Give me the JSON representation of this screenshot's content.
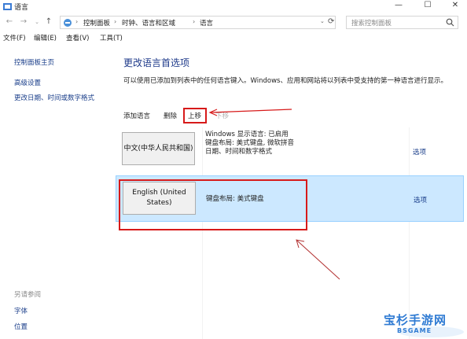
{
  "window": {
    "title": "语言",
    "controls": [
      "—",
      "☐",
      "✕"
    ]
  },
  "address": {
    "breadcrumbs": [
      "控制面板",
      "时钟、语言和区域",
      "语言"
    ],
    "search_placeholder": "搜索控制面板"
  },
  "menu": [
    "文件(F)",
    "编辑(E)",
    "查看(V)",
    "工具(T)"
  ],
  "sidebar": {
    "links": [
      "控制面板主页",
      "高级设置",
      "更改日期、时间或数字格式"
    ],
    "see_also_title": "另请参阅",
    "see_also_links": [
      "字体",
      "位置"
    ]
  },
  "main": {
    "heading": "更改语言首选项",
    "description": "可以使用已添加到列表中的任何语言键入。Windows、应用和网站将以列表中受支持的第一种语言进行显示。",
    "toolbar": {
      "add": "添加语言",
      "remove": "删除",
      "move_up": "上移",
      "move_down": "下移"
    },
    "languages": [
      {
        "name": "中文(中华人民共和国)",
        "info": "Windows 显示语言: 已启用\n键盘布局: 美式键盘, 微软拼音\n日期、时间和数字格式",
        "options": "选项"
      },
      {
        "name": "English (United States)",
        "info": "键盘布局: 美式键盘",
        "options": "选项"
      }
    ]
  },
  "watermark": {
    "text": "宝杉手游网",
    "sub": "BSGAME"
  },
  "colors": {
    "annotation_red": "#d71a1a",
    "selection": "#cce8ff",
    "link": "#1a3e8a"
  }
}
